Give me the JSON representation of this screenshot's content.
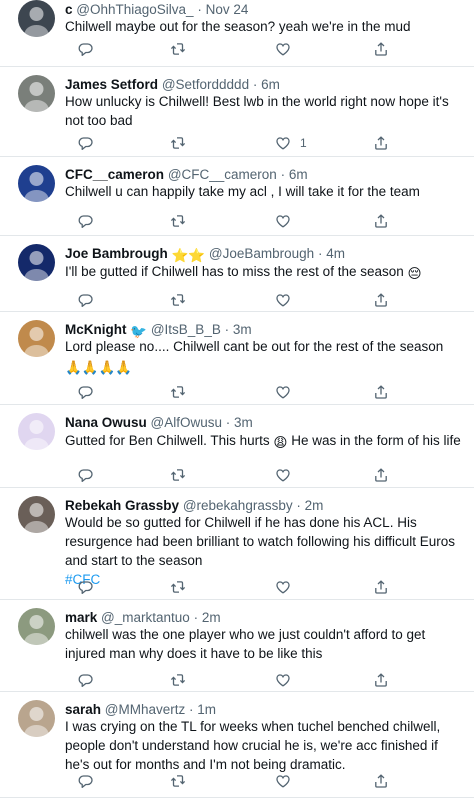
{
  "tweets": [
    {
      "name": "c",
      "handle": "@OhhThiagoSilva_",
      "dot": "·",
      "time": "Nov 24",
      "text": "Chilwell maybe out for the season? yeah we're in the mud",
      "like_count": ""
    },
    {
      "name": "James Setford",
      "handle": "@Setforddddd",
      "dot": "·",
      "time": "6m",
      "text": "How unlucky is Chilwell! Best lwb in the world right now hope it's not too bad",
      "like_count": "1"
    },
    {
      "name": "CFC__cameron",
      "handle": "@CFC__cameron",
      "dot": "·",
      "time": "6m",
      "text": "Chilwell u can happily take my acl , I will take it for the team",
      "like_count": ""
    },
    {
      "name": "Joe Bambrough",
      "name_emoji": "⭐⭐",
      "handle": "@JoeBambrough",
      "dot": "·",
      "time": "4m",
      "text": "I'll be gutted if Chilwell has to miss the rest of the season",
      "text_emoji": "😔",
      "like_count": ""
    },
    {
      "name": "McKnight",
      "name_emoji": "🐦",
      "handle": "@ItsB_B_B",
      "dot": "·",
      "time": "3m",
      "text": "Lord please no.... Chilwell cant be out for the rest of the season",
      "text_emoji": "🙏🙏🙏🙏",
      "like_count": ""
    },
    {
      "name": "Nana Owusu",
      "handle": "@AlfOwusu",
      "dot": "·",
      "time": "3m",
      "text": "Gutted for Ben Chilwell. This hurts",
      "text_emoji": "😩",
      "text_after": "He was in the form of his life",
      "like_count": ""
    },
    {
      "name": "Rebekah Grassby",
      "handle": "@rebekahgrassby",
      "dot": "·",
      "time": "2m",
      "text": "Would be so gutted for Chilwell if he has done his ACL. His resurgence had been brilliant to watch following his difficult Euros and start to the season",
      "hashtag": "#CFC",
      "like_count": ""
    },
    {
      "name": "mark",
      "handle": "@_marktantuo",
      "dot": "·",
      "time": "2m",
      "text": "chilwell was the one player who we just couldn't afford to get injured man why does it have to be like this",
      "like_count": ""
    },
    {
      "name": "sarah",
      "handle": "@MMhavertz",
      "dot": "·",
      "time": "1m",
      "text": "I was crying on the TL for weeks when tuchel benched chilwell, people don't understand how crucial he is, we're acc finished if he's out for months and I'm not being dramatic.",
      "like_count": ""
    }
  ],
  "avatar_colors": [
    "#3d4650",
    "#7a7f7a",
    "#1f3f8f",
    "#14296a",
    "#c08a4c",
    "#e0d6f0",
    "#6a5f58",
    "#8c9a7f",
    "#b9a58e"
  ],
  "icons": {
    "reply": "reply-icon",
    "retweet": "retweet-icon",
    "like": "heart-icon",
    "share": "share-icon"
  }
}
